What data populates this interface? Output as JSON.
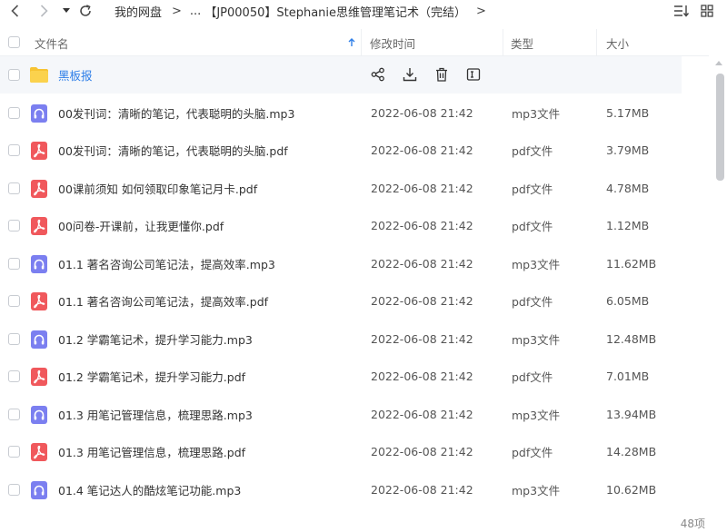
{
  "breadcrumb": {
    "root": "我的网盘",
    "ellipsis": "...",
    "current": "【JP00050】Stephanie思维管理笔记术（完结）"
  },
  "columns": {
    "name": "文件名",
    "modified": "修改时间",
    "type": "类型",
    "size": "大小"
  },
  "folder": {
    "name": "黑板报",
    "actions": [
      "share-icon",
      "download-icon",
      "delete-icon",
      "rename-icon"
    ]
  },
  "files": [
    {
      "kind": "audio",
      "name": "00发刊词：清晰的笔记，代表聪明的头脑.mp3",
      "modified": "2022-06-08 21:42",
      "type": "mp3文件",
      "size": "5.17MB"
    },
    {
      "kind": "pdf",
      "name": "00发刊词：清晰的笔记，代表聪明的头脑.pdf",
      "modified": "2022-06-08 21:42",
      "type": "pdf文件",
      "size": "3.79MB"
    },
    {
      "kind": "pdf",
      "name": "00课前须知 如何领取印象笔记月卡.pdf",
      "modified": "2022-06-08 21:42",
      "type": "pdf文件",
      "size": "4.78MB"
    },
    {
      "kind": "pdf",
      "name": "00问卷-开课前，让我更懂你.pdf",
      "modified": "2022-06-08 21:42",
      "type": "pdf文件",
      "size": "1.12MB"
    },
    {
      "kind": "audio",
      "name": "01.1 著名咨询公司笔记法，提高效率.mp3",
      "modified": "2022-06-08 21:42",
      "type": "mp3文件",
      "size": "11.62MB"
    },
    {
      "kind": "pdf",
      "name": "01.1 著名咨询公司笔记法，提高效率.pdf",
      "modified": "2022-06-08 21:42",
      "type": "pdf文件",
      "size": "6.05MB"
    },
    {
      "kind": "audio",
      "name": "01.2 学霸笔记术，提升学习能力.mp3",
      "modified": "2022-06-08 21:42",
      "type": "mp3文件",
      "size": "12.48MB"
    },
    {
      "kind": "pdf",
      "name": "01.2 学霸笔记术，提升学习能力.pdf",
      "modified": "2022-06-08 21:42",
      "type": "pdf文件",
      "size": "7.01MB"
    },
    {
      "kind": "audio",
      "name": "01.3 用笔记管理信息，梳理思路.mp3",
      "modified": "2022-06-08 21:42",
      "type": "mp3文件",
      "size": "13.94MB"
    },
    {
      "kind": "pdf",
      "name": "01.3 用笔记管理信息，梳理思路.pdf",
      "modified": "2022-06-08 21:42",
      "type": "pdf文件",
      "size": "14.28MB"
    },
    {
      "kind": "audio",
      "name": "01.4 笔记达人的酷炫笔记功能.mp3",
      "modified": "2022-06-08 21:42",
      "type": "mp3文件",
      "size": "10.62MB"
    }
  ],
  "footer": {
    "count": "48项"
  },
  "colors": {
    "audio_icon": "#7b7ff0",
    "pdf_icon": "#f0585c",
    "folder_icon": "#f7c332",
    "accent": "#2f7fe8"
  }
}
